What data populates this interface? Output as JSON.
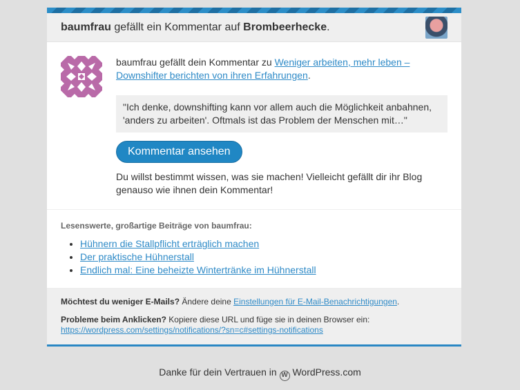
{
  "header": {
    "actor": "baumfrau",
    "text": "gefällt ein Kommentar auf",
    "site": "Brombeerhecke",
    "punct": "."
  },
  "main": {
    "intro_text": "baumfrau gefällt dein Kommentar zu",
    "post_link": "Weniger arbeiten, mehr leben – Downshifter berichten von ihren Erfahrungen",
    "intro_end": ".",
    "quote": "\"Ich denke, downshifting kann vor allem auch die Möglichkeit anbahnen, 'anders zu arbeiten'. Oftmals ist das Problem der Menschen mit…\"",
    "button_label": "Kommentar ansehen",
    "follow_text": "Du willst bestimmt wissen, was sie machen! Vielleicht gefällt dir ihr Blog genauso wie ihnen dein Kommentar!"
  },
  "posts": {
    "heading": "Lesenswerte, großartige Beiträge von baumfrau:",
    "items": [
      "Hühnern die Stallpflicht erträglich machen",
      "Der praktische Hühnerstall",
      "Endlich mal: Eine beheizte Wintertränke im Hühnerstall"
    ]
  },
  "footer": {
    "q1_bold": "Möchtest du weniger E-Mails?",
    "q1_text": "Ändere deine",
    "q1_link": "Einstellungen für E-Mail-Benachrichtigungen",
    "q1_end": ".",
    "q2_bold": "Probleme beim Anklicken?",
    "q2_text": "Kopiere diese URL und füge sie in deinen Browser ein:",
    "url": "https://wordpress.com/settings/notifications/?sn=c#settings-notifications"
  },
  "thanks": {
    "prefix": "Danke für dein Vertrauen in",
    "brand": "WordPress.com"
  },
  "colors": {
    "accent": "#2087c4",
    "link": "#2e8ac7",
    "identicon": "#b96aa8"
  }
}
